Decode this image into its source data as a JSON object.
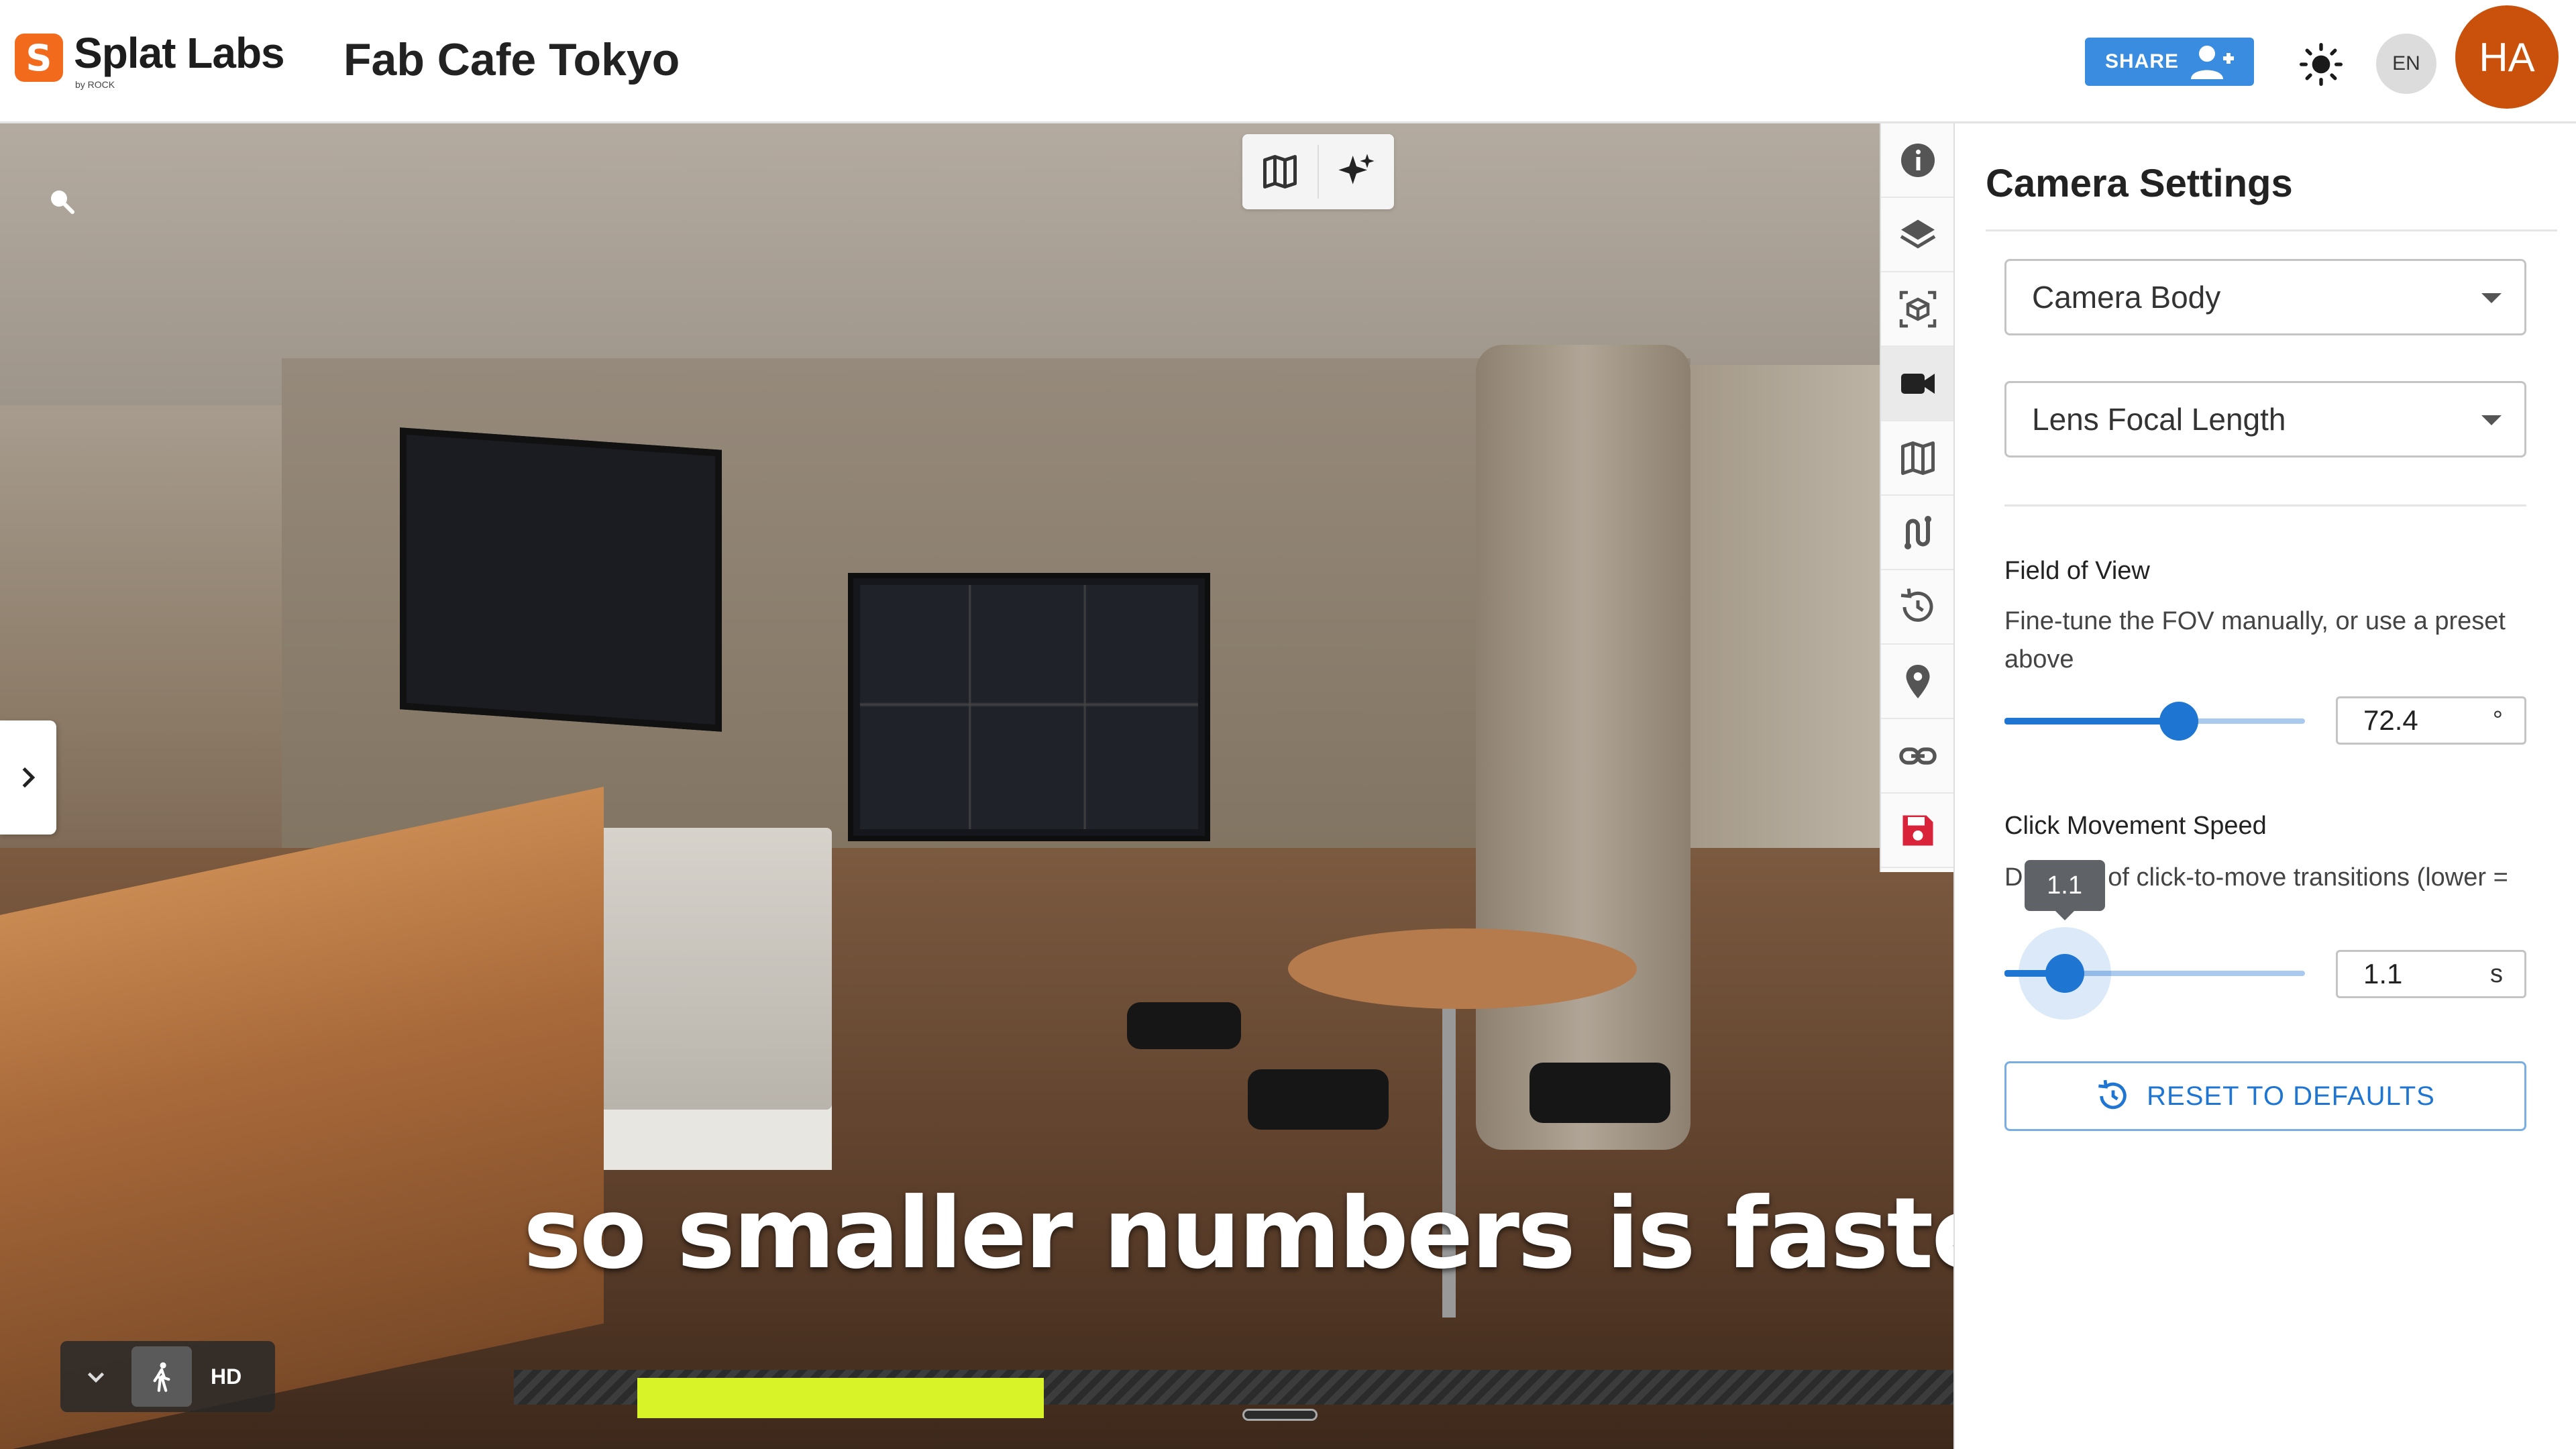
{
  "header": {
    "logo_badge": "S",
    "logo_name": "Splat Labs",
    "logo_sub": "by ROCK",
    "project_title": "Fab Cafe Tokyo",
    "share_label": "SHARE",
    "language": "EN",
    "avatar_initials": "HA",
    "accent_color": "#f26a1b",
    "share_color": "#3a8ce0"
  },
  "viewport": {
    "caption": "so smaller numbers is faster movements",
    "quality_label": "HD",
    "top_tools": [
      "map-icon",
      "sparkles-icon"
    ]
  },
  "toolstrip": {
    "tools": [
      "info-icon",
      "layers-icon",
      "3d-box-icon",
      "camera-icon",
      "map-icon",
      "path-icon",
      "history-icon",
      "location-pin-icon",
      "link-icon",
      "save-icon"
    ],
    "active": "camera-icon"
  },
  "panel": {
    "title": "Camera Settings",
    "camera_body": "Camera Body",
    "lens_focal": "Lens Focal Length",
    "fov": {
      "title": "Field of View",
      "description": "Fine-tune the FOV manually, or use a preset above",
      "value": "72.4",
      "unit": "°",
      "slider_fraction": 0.58
    },
    "speed": {
      "title": "Click Movement Speed",
      "description": "Duration of click-to-move transitions (lower =",
      "value": "1.1",
      "unit": "s",
      "tooltip": "1.1",
      "slider_fraction": 0.2
    },
    "reset_label": "RESET TO DEFAULTS",
    "slider_color": "#1e76d2"
  }
}
